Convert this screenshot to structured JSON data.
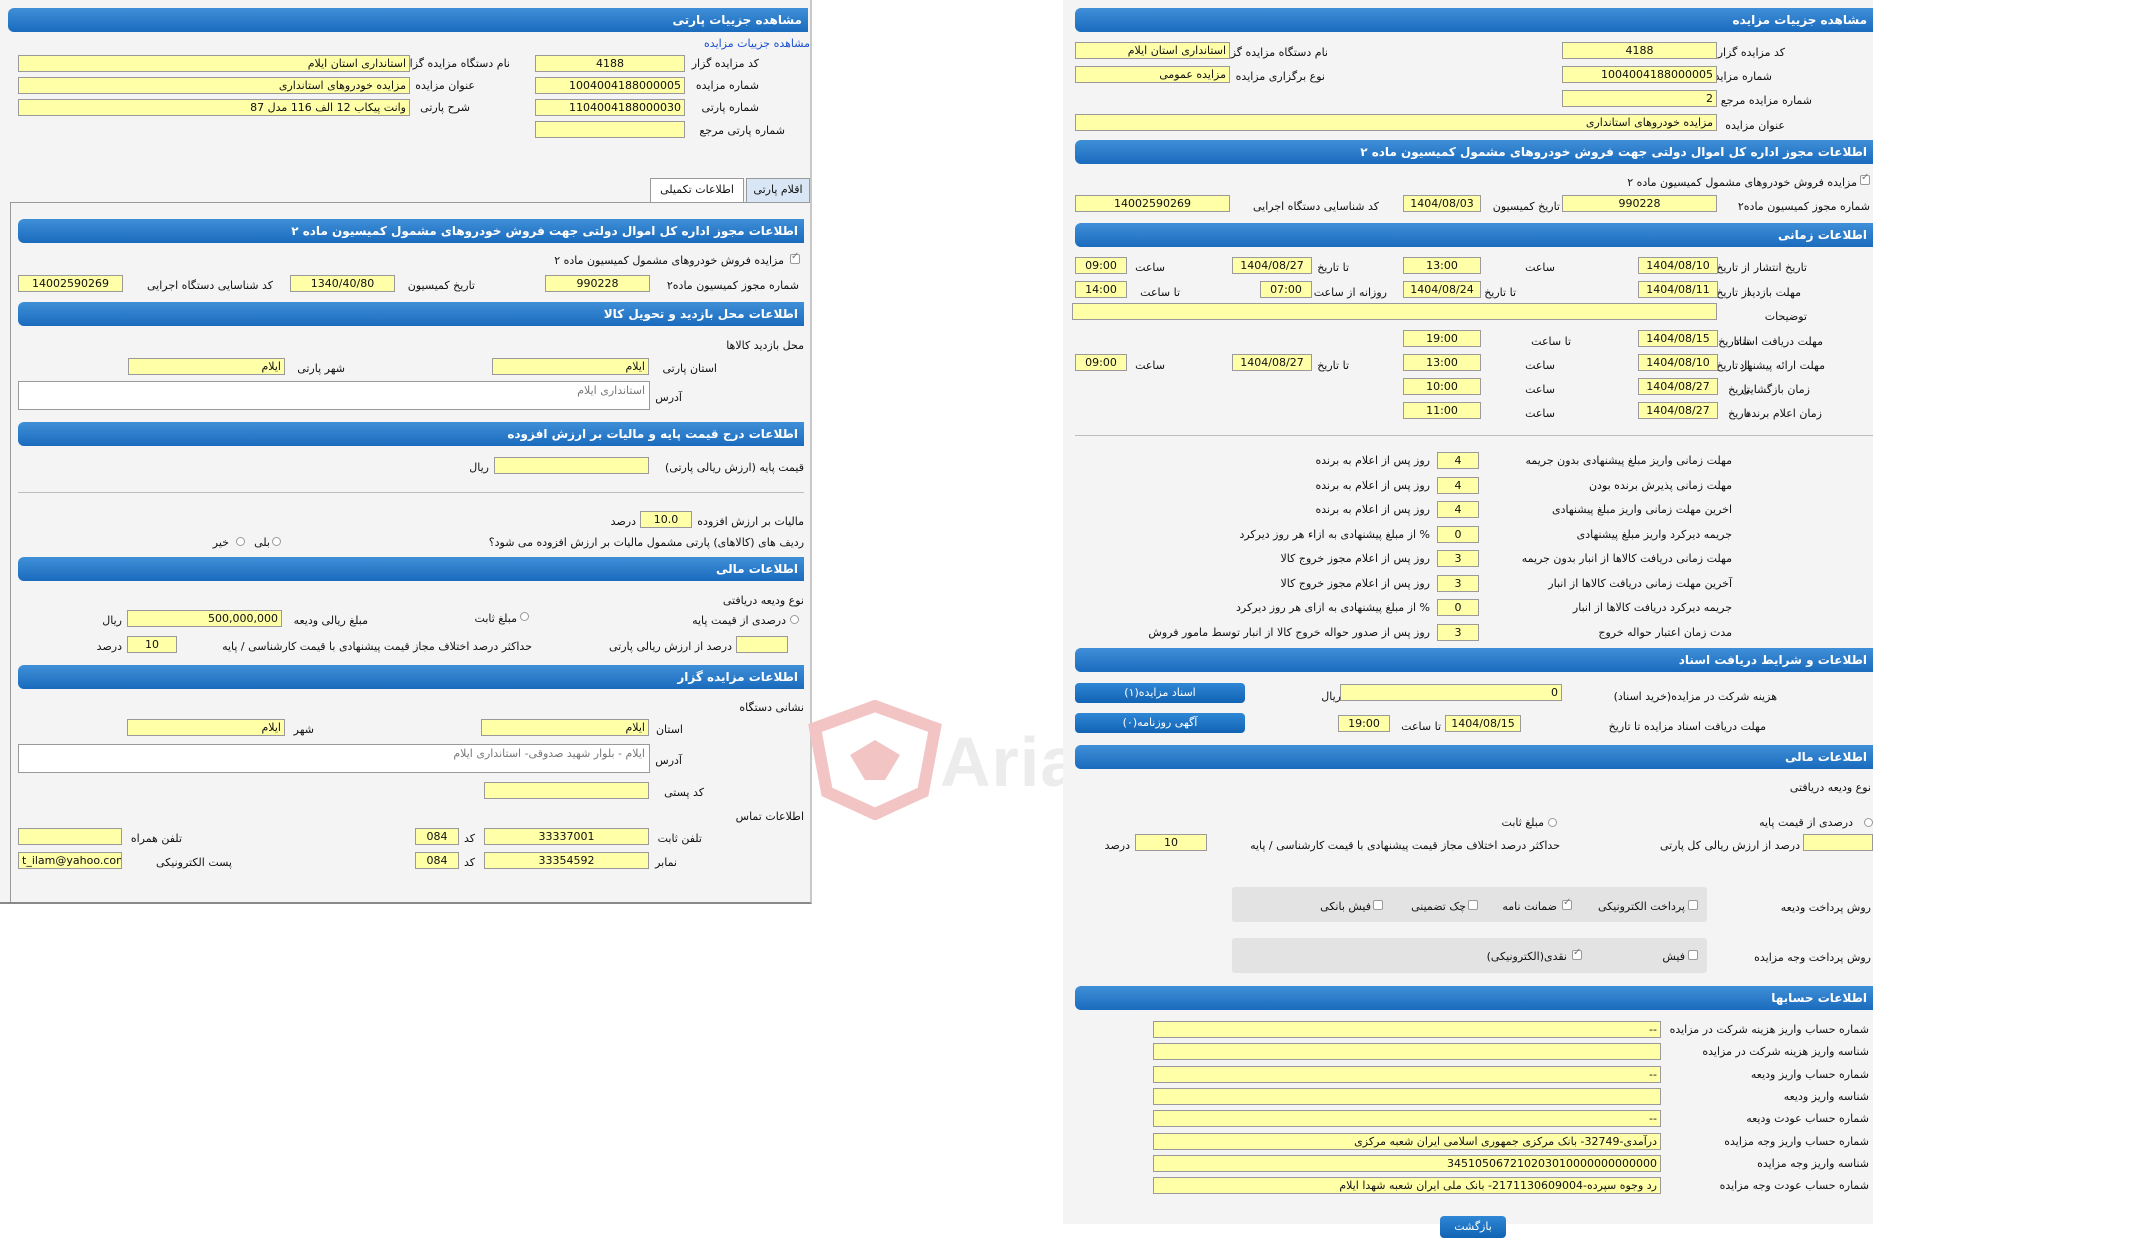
{
  "left": {
    "title": "مشاهده جزییات پارتی",
    "link": "مشاهده جزییات مزایده",
    "org_label": "نام دستگاه مزایده گزار",
    "org_value": "استانداری استان ایلام",
    "code_label": "کد مزایده گزار",
    "code_value": "4188",
    "auction_title_label": "عنوان مزایده",
    "auction_title_value": "مزایده خودروهای استانداری",
    "auction_no_label": "شماره مزایده",
    "auction_no_value": "1004004188000005",
    "party_desc_label": "شرح پارتی",
    "party_desc_value": "وانت پیکاب 12 الف 116 مدل 87",
    "party_no_label": "شماره پارتی",
    "party_no_value": "1104004188000030",
    "party_ref_label": "شماره پارتی مرجع",
    "party_ref_value": "",
    "tab_items": "اقلام پارتی",
    "tab_extra": "اطلاعات تکمیلی",
    "permit_bar": "اطلاعات مجوز اداره کل اموال دولتی جهت فروش خودروهای مشمول کمیسیون ماده ۲",
    "permit_check_label": "مزایده فروش خودروهای مشمول کمیسیون ماده ۲",
    "permit_no_label": "شماره مجوز کمیسیون ماده۲",
    "permit_no_value": "990228",
    "comm_date_label": "تاریخ کمیسیون",
    "comm_date_value": "1340/40/80",
    "exec_id_label": "کد شناسایی دستگاه اجرایی",
    "exec_id_value": "14002590269",
    "visit_bar": "اطلاعات محل بازدید و تحویل کالا",
    "visit_place_label": "محل بازدید کالاها",
    "province_label": "استان پارتی",
    "province_value": "ایلام",
    "city_label": "شهر پارتی",
    "city_value": "ایلام",
    "address_label": "آدرس",
    "address_value": "استانداری ایلام",
    "price_bar": "اطلاعات درج قیمت پایه و مالیات بر ارزش افزوده",
    "base_price_label": "قیمت پایه (ارزش ریالی پارتی)",
    "base_price_value": "",
    "rial": "ریال",
    "vat_label": "مالیات بر ارزش افزوده",
    "vat_value": "10.0",
    "percent": "درصد",
    "vat_question": "ردیف های (کالاهای) پارتی مشمول مالیات بر ارزش افزوده می شود؟",
    "yes": "بلی",
    "no": "خیر",
    "finance_bar": "اطلاعات مالی",
    "deposit_type_label": "نوع ودیعه دریافتی",
    "percent_of_base": "درصدی از قیمت پایه",
    "fixed_amount": "مبلغ ثابت",
    "deposit_amount_label": "مبلغ ریالی ودیعه",
    "deposit_amount_value": "500,000,000",
    "percent_of_party_label": "درصد از ارزش ریالی پارتی",
    "percent_of_party_value": "",
    "max_diff_label": "حداکثر درصد اختلاف مجاز قیمت پیشنهادی با قیمت کارشناسی / پایه",
    "max_diff_value": "10",
    "organizer_bar": "اطلاعات مزایده گزار",
    "org_address_label": "نشانی دستگاه",
    "org_province_label": "استان",
    "org_province_value": "ایلام",
    "org_city_label": "شهر",
    "org_city_value": "ایلام",
    "org_address_value": "ایلام - بلوار شهید صدوقی- استانداری ایلام",
    "postal_label": "کد پستی",
    "postal_value": "",
    "contact_label": "اطلاعات تماس",
    "phone_label": "تلفن ثابت",
    "phone_value": "33337001",
    "area_code_label": "کد",
    "area_code_value": "084",
    "mobile_label": "تلفن همراه",
    "mobile_value": "",
    "fax_label": "نمابر",
    "fax_value": "33354592",
    "fax_code_value": "084",
    "email_label": "پست الکترونیکی",
    "email_value": "t_ilam@yahoo.com"
  },
  "right": {
    "title": "مشاهده جزییات مزایده",
    "code_label": "کد مزایده گزار",
    "code_value": "4188",
    "org_label": "نام دستگاه مزایده گزار",
    "org_value": "استانداری استان ایلام",
    "auction_no_label": "شماره مزایده",
    "auction_no_value": "1004004188000005",
    "hold_type_label": "نوع برگزاری مزایده",
    "hold_type_value": "مزایده عمومی",
    "ref_no_label": "شماره مزایده مرجع",
    "ref_no_value": "2",
    "title_label": "عنوان مزایده",
    "title_value": "مزایده خودروهای استانداری",
    "permit_bar": "اطلاعات مجوز اداره کل اموال دولتی جهت فروش خودروهای مشمول کمیسیون ماده ۲",
    "permit_check_label": "مزایده فروش خودروهای مشمول کمیسیون ماده ۲",
    "permit_no_label": "شماره مجوز کمیسیون ماده۲",
    "permit_no_value": "990228",
    "comm_date_label": "تاریخ کمیسیون",
    "comm_date_value": "1404/08/03",
    "exec_id_label": "کد شناسایی دستگاه اجرایی",
    "exec_id_value": "14002590269",
    "time_bar": "اطلاعات زمانی",
    "publish_label": "تاریخ انتشار",
    "from_date": "از تاریخ",
    "to_date": "تا تاریخ",
    "time_label": "ساعت",
    "to_time": "تا ساعت",
    "daily_from": "روزانه از ساعت",
    "publish_from": "1404/08/10",
    "publish_from_time": "13:00",
    "publish_to": "1404/08/27",
    "publish_to_time": "09:00",
    "visit_label": "مهلت بازدید",
    "visit_from": "1404/08/11",
    "visit_to": "1404/08/24",
    "visit_daily_from": "07:00",
    "visit_daily_to": "14:00",
    "desc_label": "توضیحات",
    "desc_value": "",
    "docs_label": "مهلت دریافت اسناد",
    "docs_to": "1404/08/15",
    "docs_to_time": "19:00",
    "offer_label": "مهلت ارائه پیشنهاد",
    "offer_from": "1404/08/10",
    "offer_from_time": "13:00",
    "offer_to": "1404/08/27",
    "offer_to_time": "09:00",
    "open_label": "زمان بازگشایی",
    "date_label": "تاریخ",
    "open_date": "1404/08/27",
    "open_time": "10:00",
    "announce_label": "زمان اعلام برنده",
    "announce_date": "1404/08/27",
    "announce_time": "11:00",
    "rules": [
      {
        "label": "مهلت زمانی واریز مبلغ پیشنهادی بدون جریمه",
        "value": "4",
        "unit": "روز پس از اعلام به برنده"
      },
      {
        "label": "مهلت زمانی پذیرش برنده بودن",
        "value": "4",
        "unit": "روز پس از اعلام به برنده"
      },
      {
        "label": "اخرین مهلت زمانی واریز مبلغ پیشنهادی",
        "value": "4",
        "unit": "روز پس از اعلام به برنده"
      },
      {
        "label": "جریمه دیرکرد واریز مبلغ پیشنهادی",
        "value": "0",
        "unit": "% از مبلغ پیشنهادی به ازاء هر روز دیرکرد"
      },
      {
        "label": "مهلت زمانی دریافت کالاها از انبار بدون جریمه",
        "value": "3",
        "unit": "روز پس از اعلام مجوز خروج کالا"
      },
      {
        "label": "آخرین مهلت زمانی دریافت کالاها از انبار",
        "value": "3",
        "unit": "روز پس از اعلام مجوز خروج کالا"
      },
      {
        "label": "جریمه دیرکرد دریافت کالاها از انبار",
        "value": "0",
        "unit": "% از مبلغ پیشنهادی به ازای هر روز دیرکرد"
      },
      {
        "label": "مدت زمان اعتبار حواله خروج",
        "value": "3",
        "unit": "روز پس از صدور حواله خروج کالا از انبار توسط مامور فروش"
      }
    ],
    "docs_bar": "اطلاعات و شرایط دریافت اسناد",
    "fee_label": "هزینه شرکت در مزایده(خرید اسناد)",
    "fee_value": "0",
    "rial": "ریال",
    "btn_docs": "اسناد مزایده(۱)",
    "btn_news": "آگهی روزنامه(۰)",
    "docs_deadline_label": "مهلت دریافت اسناد مزایده تا تاریخ",
    "docs_deadline_date": "1404/08/15",
    "until_time": "تا ساعت",
    "docs_deadline_time": "19:00",
    "finance_bar": "اطلاعات مالی",
    "deposit_type_label": "نوع ودیعه دریافتی",
    "percent_of_base": "درصدی از قیمت پایه",
    "fixed_amount": "مبلغ ثابت",
    "percent_of_party_label": "درصد از ارزش ریالی کل پارتی",
    "percent_of_party_value": "",
    "max_diff_label": "حداکثر درصد اختلاف مجاز قیمت پیشنهادی با قیمت کارشناسی / پایه",
    "max_diff_value": "10",
    "percent": "درصد",
    "deposit_pay_label": "روش پرداخت ودیعه",
    "pay_electronic": "پرداخت الکترونیکی",
    "pay_guarantee": "ضمانت نامه",
    "pay_check": "چک تضمینی",
    "pay_receipt": "فیش بانکی",
    "price_pay_label": "روش پرداخت وجه مزایده",
    "price_receipt": "فیش",
    "price_cash": "نقدی(الکترونیکی)",
    "accounts_bar": "اطلاعات حسابها",
    "accounts": [
      {
        "label": "شماره حساب واریز هزینه شرکت در مزایده",
        "value": "--"
      },
      {
        "label": "شناسه واریز هزینه شرکت در مزایده",
        "value": ""
      },
      {
        "label": "شماره حساب واریز ودیعه",
        "value": "--"
      },
      {
        "label": "شناسه واریز ودیعه",
        "value": ""
      },
      {
        "label": "شماره حساب عودت ودیعه",
        "value": "--"
      },
      {
        "label": "شماره حساب واریز وجه مزایده",
        "value": "درآمدی-32749- بانک مرکزی جمهوری اسلامی ایران شعبه مرکزی"
      },
      {
        "label": "شناسه واریز وجه مزایده",
        "value": "345105067210203010000000000000"
      },
      {
        "label": "شماره حساب عودت وجه مزایده",
        "value": "رد وجوه سپرده-2171130609004- بانک ملی ایران شعبه شهدا ایلام"
      }
    ],
    "back_button": "بازگشت"
  },
  "watermark": "AriaTender.neT"
}
